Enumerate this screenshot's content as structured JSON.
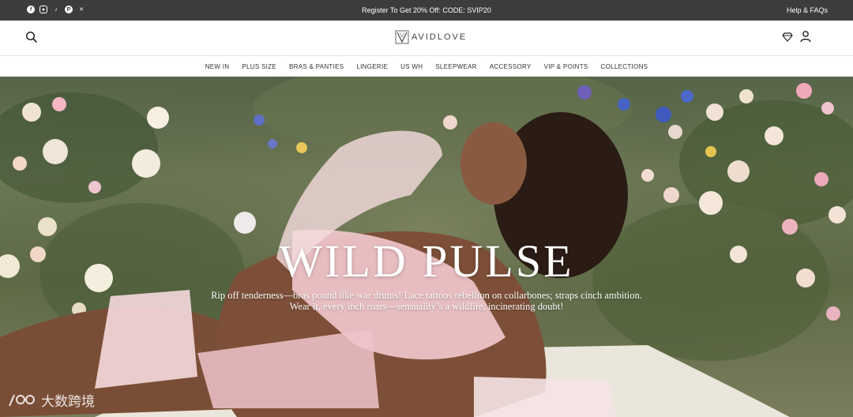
{
  "announcement": {
    "promo_text": "Register To Get 20% Off: CODE: SVIP20",
    "help_link": "Help & FAQs",
    "social_icons": [
      "facebook-icon",
      "instagram-icon",
      "tiktok-icon",
      "pinterest-icon",
      "x-icon"
    ]
  },
  "header": {
    "logo_text": "AVIDLOVE",
    "icons": [
      "search-icon",
      "diamond-icon",
      "user-icon"
    ]
  },
  "nav": {
    "items": [
      "NEW IN",
      "PLUS SIZE",
      "BRAS & PANTIES",
      "LINGERIE",
      "US WH",
      "SLEEPWEAR",
      "ACCESSORY",
      "VIP & POINTS",
      "COLLECTIONS"
    ]
  },
  "hero": {
    "title": "WILD PULSE",
    "subtitle_line1": "Rip off tenderness—bras pound like war drums! Lace tattoos rebellion on collarbones; straps cinch ambition.",
    "subtitle_line2": "Wear it, every inch roars—sensuality’s a wildfire, incinerating doubt!"
  },
  "watermark": {
    "text": "大数跨境"
  },
  "colors": {
    "topbar_bg": "#3c3c3c",
    "hero_text": "#ffffff",
    "lingerie_pink": "#f3c9cf"
  }
}
